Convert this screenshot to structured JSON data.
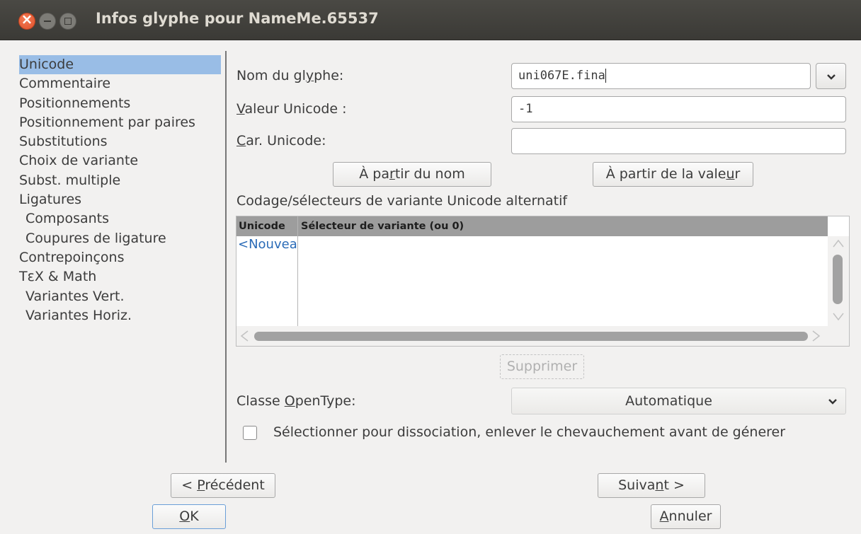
{
  "window": {
    "title": "Infos glyphe pour NameMe.65537"
  },
  "sidebar": {
    "items": [
      {
        "label": "Unicode",
        "selected": true
      },
      {
        "label": "Commentaire"
      },
      {
        "label": "Positionnements"
      },
      {
        "label": "Positionnement par paires"
      },
      {
        "label": "Substitutions"
      },
      {
        "label": "Choix de variante"
      },
      {
        "label": "Subst. multiple"
      },
      {
        "label": "Ligatures"
      },
      {
        "label": "Composants"
      },
      {
        "label": "Coupures de ligature"
      },
      {
        "label": "Contrepoinçons"
      },
      {
        "label": "TεX & Math"
      },
      {
        "label": "Variantes Vert."
      },
      {
        "label": "Variantes Horiz."
      }
    ]
  },
  "form": {
    "glyph_name_label_pre": "Nom du gl",
    "glyph_name_label_key": "y",
    "glyph_name_label_post": "phe:",
    "glyph_name_value": "uni067E.fina",
    "unicode_value_label_key": "V",
    "unicode_value_label_post": "aleur Unicode :",
    "unicode_value": "-1",
    "unicode_char_label_key": "C",
    "unicode_char_label_post": "ar. Unicode:",
    "unicode_char_value": "",
    "from_name_pre": "À pa",
    "from_name_key": "r",
    "from_name_post": "tir du nom",
    "from_value_pre": "À partir de la vale",
    "from_value_key": "u",
    "from_value_post": "r"
  },
  "alt_table": {
    "heading": "Codage/sélecteurs de variante Unicode alternatif",
    "columns": [
      "Unicode",
      "Sélecteur de variante (ou 0)"
    ],
    "rows": [
      {
        "unicode": "<Nouveau>",
        "selector": ""
      }
    ],
    "delete_label": "Supprimer"
  },
  "opentype": {
    "label_pre": "Classe ",
    "label_key": "O",
    "label_post": "penType:",
    "value": "Automatique"
  },
  "detach": {
    "label": "Sélectionner pour dissociation, enlever le chevauchement avant de génerer",
    "checked": false
  },
  "footer": {
    "prev_pre": "< ",
    "prev_key": "P",
    "prev_post": "récédent",
    "next_pre": "Suiva",
    "next_key": "n",
    "next_post": "t >",
    "ok_key": "O",
    "ok_post": "K",
    "cancel_key": "A",
    "cancel_post": "nnuler"
  }
}
